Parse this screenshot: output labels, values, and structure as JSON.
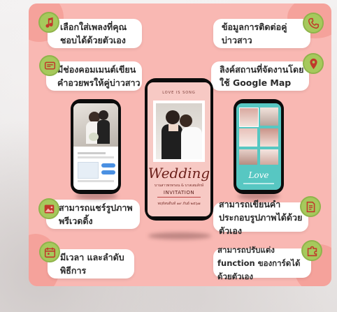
{
  "features": {
    "music": "เลือกใส่เพลงที่คุณชอบได้ด้วยตัวเอง",
    "contact": "ข้อมูลการติดต่อคู่บ่าวสาว",
    "comments": "มีช่องคอมเมนต์เขียนคำอวยพรให้คู่บ่าวสาว",
    "map": "ลิงค์สถานที่จัดงานโดยใช้ Google Map",
    "share": "สามารถแชร์รูปภาพพรีเวดดิ้ง",
    "caption": "สามารถเขียนคำประกอบรูปภาพได้ด้วยตัวเอง",
    "schedule": "มีเวลา และลำดับพิธีการ",
    "customize": "สามารถปรับแต่ง function ของการ์ดได้ด้วยตัวเอง"
  },
  "center_phone": {
    "tagline": "LOVE IS SONG",
    "script_title": "Wedding",
    "couple_line": "บานสาวพรทรอน & บาสเสมลักษ์",
    "invitation": "INVITATION",
    "date_line": "พฤหัสบดีนท์ ๑๙ ภันย์ ๒๕๖๗"
  },
  "right_phone": {
    "script": "Love"
  },
  "colors": {
    "panel": "#f9b8b3",
    "badge": "#a6c95c",
    "accent_red": "#d9534f",
    "teal": "#57c7c2"
  },
  "icons": {
    "music": "music-note-icon",
    "contact": "phone-icon",
    "comments": "comment-icon",
    "map": "map-pin-icon",
    "share": "image-icon",
    "caption": "document-icon",
    "schedule": "calendar-icon",
    "customize": "puzzle-icon"
  }
}
